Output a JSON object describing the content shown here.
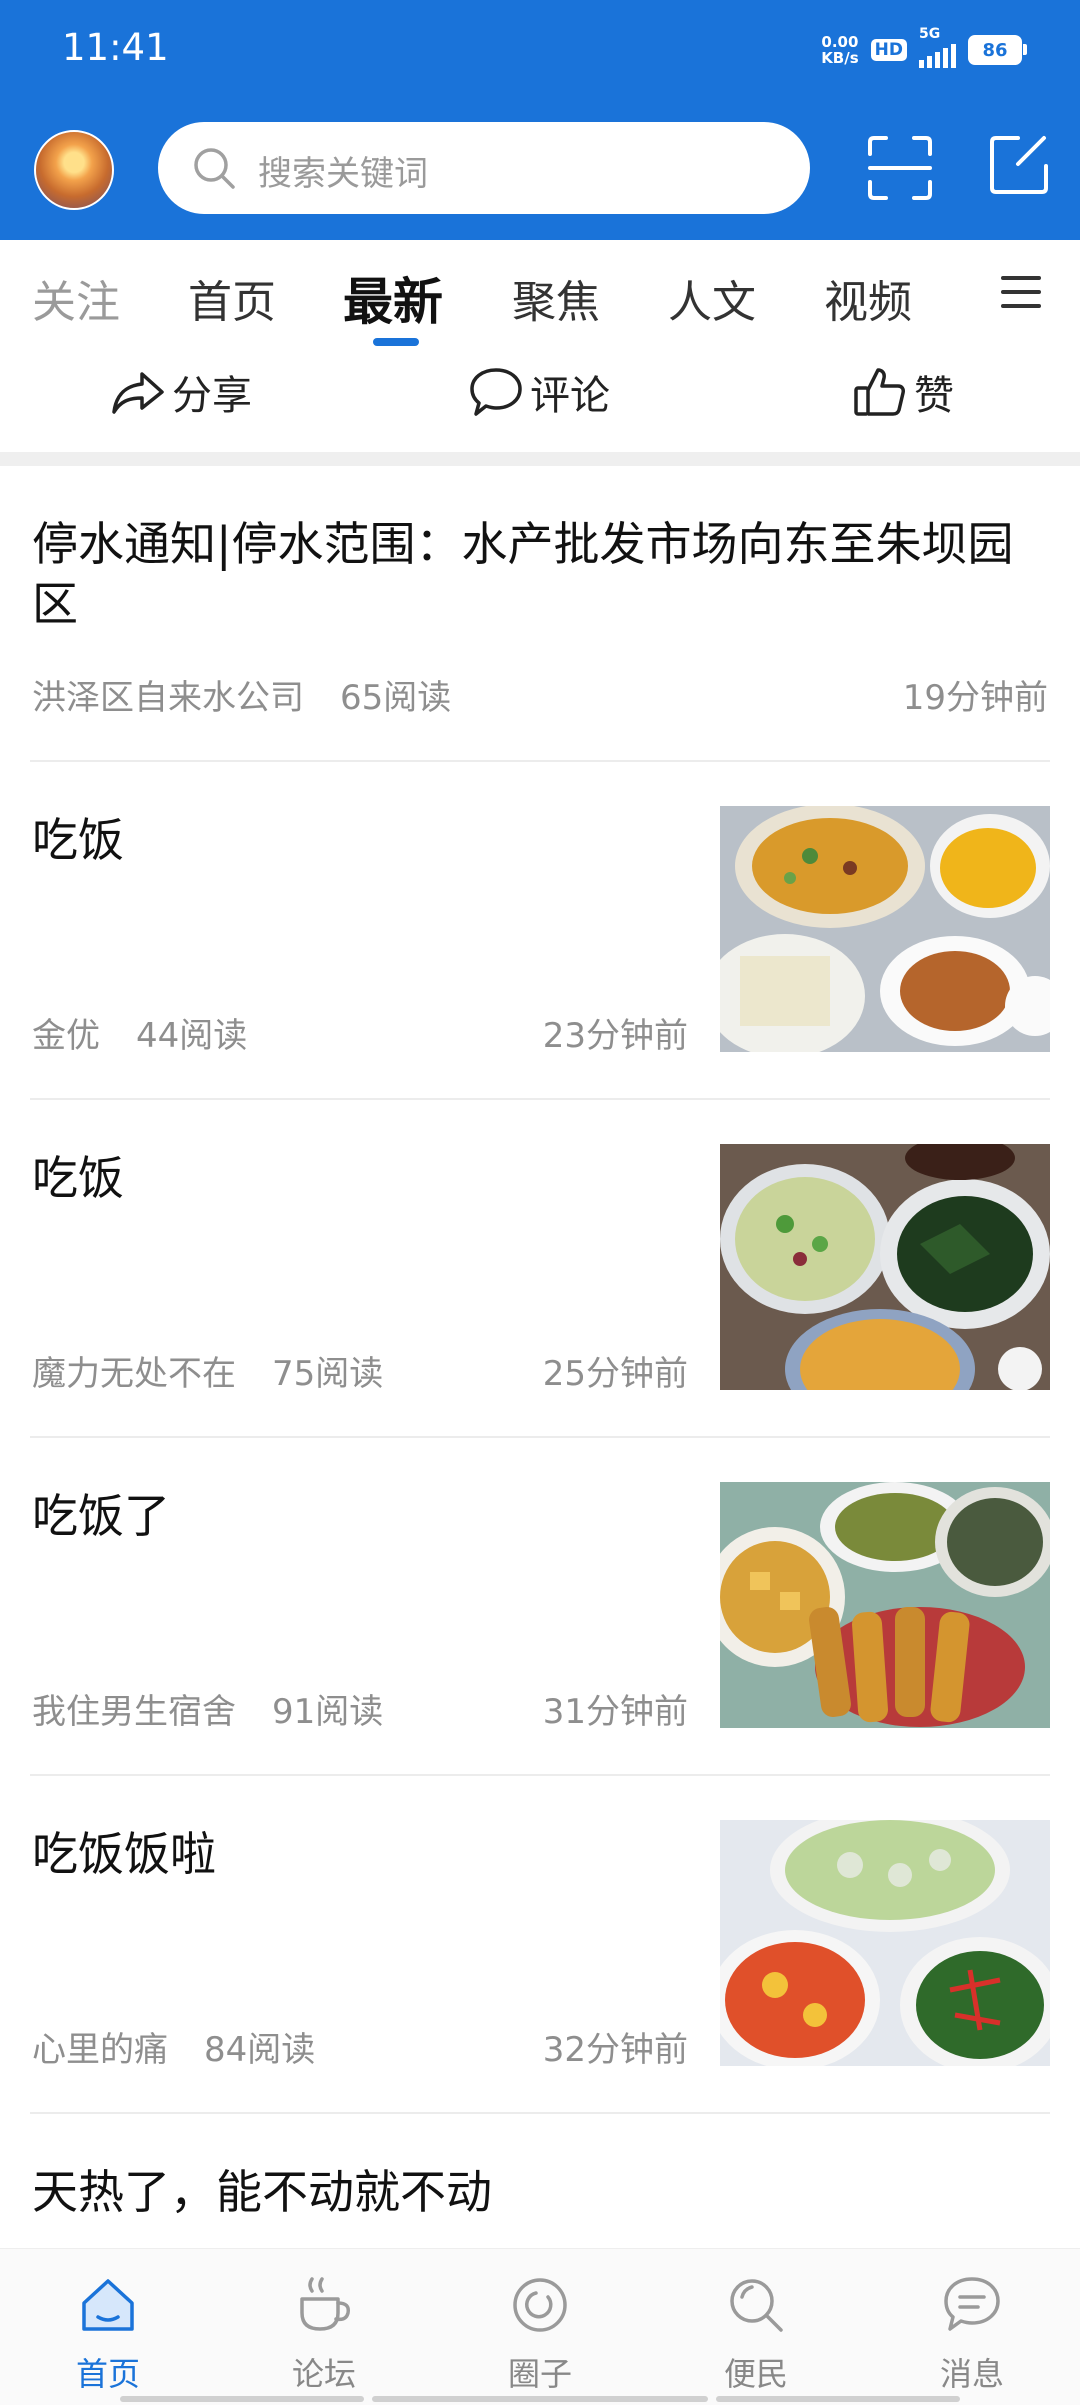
{
  "status_bar": {
    "time": "11:41",
    "net_speed_value": "0.00",
    "net_speed_unit": "KB/s",
    "hd": "HD",
    "network": "5G",
    "battery": "86"
  },
  "search": {
    "placeholder": "搜索关键词"
  },
  "tabs": [
    {
      "label": "关注"
    },
    {
      "label": "首页"
    },
    {
      "label": "最新",
      "active": true
    },
    {
      "label": "聚焦"
    },
    {
      "label": "人文"
    },
    {
      "label": "视频"
    }
  ],
  "actions": {
    "share": "分享",
    "comment": "评论",
    "like": "赞"
  },
  "feed": [
    {
      "title": "停水通知|停水范围：水产批发市场向东至朱坝园区",
      "author": "洪泽区自来水公司",
      "reads": "65阅读",
      "time": "19分钟前"
    },
    {
      "title": "吃饭",
      "author": "金优",
      "reads": "44阅读",
      "time": "23分钟前"
    },
    {
      "title": "吃饭",
      "author": "魔力无处不在",
      "reads": "75阅读",
      "time": "25分钟前"
    },
    {
      "title": "吃饭了",
      "author": "我住男生宿舍",
      "reads": "91阅读",
      "time": "31分钟前"
    },
    {
      "title": "吃饭饭啦",
      "author": "心里的痛",
      "reads": "84阅读",
      "time": "32分钟前"
    },
    {
      "title": "天热了，能不动就不动"
    }
  ],
  "bottom_nav": [
    {
      "label": "首页",
      "icon": "home-icon",
      "active": true
    },
    {
      "label": "论坛",
      "icon": "coffee-cup-icon"
    },
    {
      "label": "圈子",
      "icon": "circle-icon"
    },
    {
      "label": "便民",
      "icon": "search-icon"
    },
    {
      "label": "消息",
      "icon": "chat-bubble-icon"
    }
  ],
  "colors": {
    "brand": "#1a73d9",
    "meta_text": "#8e8e8e",
    "divider": "#ececec"
  }
}
